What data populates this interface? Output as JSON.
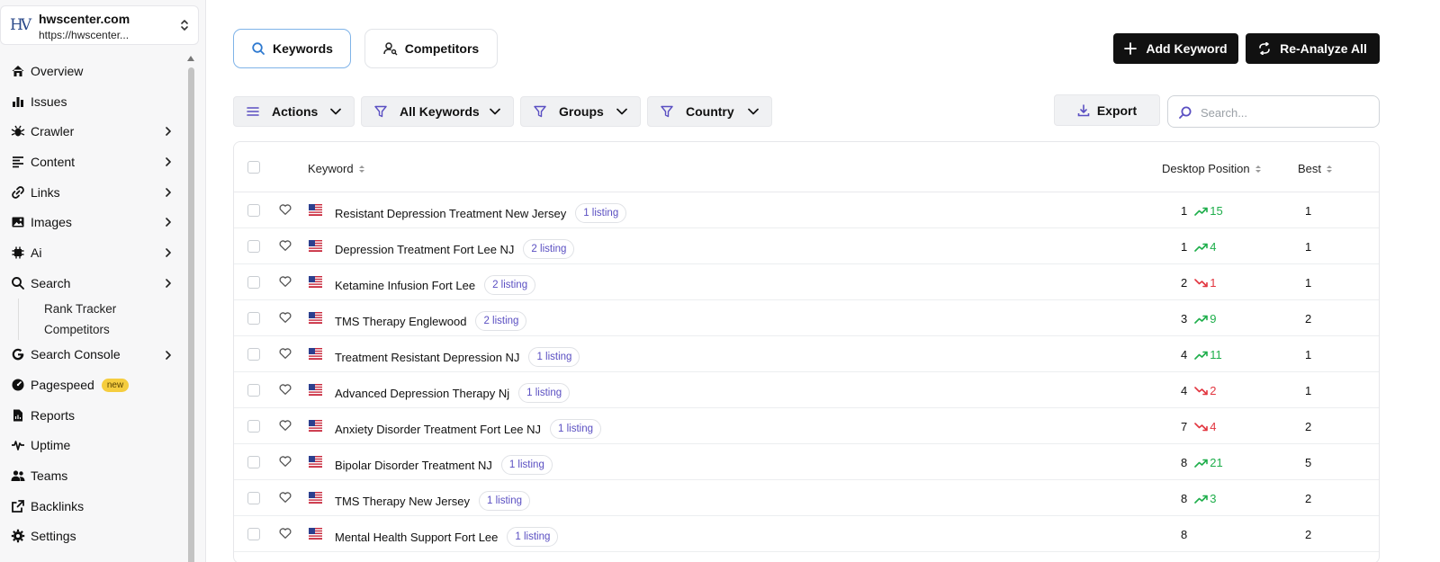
{
  "sidebar": {
    "site_name": "hwscenter.com",
    "site_url": "https://hwscenter...",
    "items": [
      {
        "label": "Overview",
        "icon": "home-icon",
        "chevron": false
      },
      {
        "label": "Issues",
        "icon": "bar-chart-icon",
        "chevron": false
      },
      {
        "label": "Crawler",
        "icon": "bug-icon",
        "chevron": true
      },
      {
        "label": "Content",
        "icon": "align-left-icon",
        "chevron": true
      },
      {
        "label": "Links",
        "icon": "link-icon",
        "chevron": true
      },
      {
        "label": "Images",
        "icon": "image-icon",
        "chevron": true
      },
      {
        "label": "Ai",
        "icon": "chip-icon",
        "chevron": true
      },
      {
        "label": "Search",
        "icon": "search-icon",
        "chevron": true
      }
    ],
    "search_subitems": [
      "Rank Tracker",
      "Competitors"
    ],
    "items_after": [
      {
        "label": "Search Console",
        "icon": "google-icon",
        "chevron": true
      },
      {
        "label": "Pagespeed",
        "icon": "speedometer-icon",
        "chevron": false,
        "badge": "new"
      },
      {
        "label": "Reports",
        "icon": "file-icon",
        "chevron": false
      },
      {
        "label": "Uptime",
        "icon": "pulse-icon",
        "chevron": false
      },
      {
        "label": "Teams",
        "icon": "users-icon",
        "chevron": false
      },
      {
        "label": "Backlinks",
        "icon": "external-link-icon",
        "chevron": false
      },
      {
        "label": "Settings",
        "icon": "gear-icon",
        "chevron": false
      }
    ]
  },
  "tabs": {
    "keywords": "Keywords",
    "competitors": "Competitors"
  },
  "actions": {
    "add_keyword": "Add Keyword",
    "reanalyze": "Re-Analyze All"
  },
  "filters": {
    "actions": "Actions",
    "all_keywords": "All Keywords",
    "groups": "Groups",
    "country": "Country"
  },
  "export_label": "Export",
  "search": {
    "placeholder": "Search..."
  },
  "table": {
    "headers": {
      "keyword": "Keyword",
      "desktop_position": "Desktop Position",
      "best": "Best"
    },
    "rows": [
      {
        "keyword": "Resistant Depression Treatment New Jersey",
        "listing": "1 listing",
        "position": "1",
        "change": "15",
        "direction": "up",
        "best": "1"
      },
      {
        "keyword": "Depression Treatment Fort Lee NJ",
        "listing": "2 listing",
        "position": "1",
        "change": "4",
        "direction": "up",
        "best": "1"
      },
      {
        "keyword": "Ketamine Infusion Fort Lee",
        "listing": "2 listing",
        "position": "2",
        "change": "1",
        "direction": "down",
        "best": "1"
      },
      {
        "keyword": "TMS Therapy Englewood",
        "listing": "2 listing",
        "position": "3",
        "change": "9",
        "direction": "up",
        "best": "2"
      },
      {
        "keyword": "Treatment Resistant Depression NJ",
        "listing": "1 listing",
        "position": "4",
        "change": "11",
        "direction": "up",
        "best": "1"
      },
      {
        "keyword": "Advanced Depression Therapy Nj",
        "listing": "1 listing",
        "position": "4",
        "change": "2",
        "direction": "down",
        "best": "1"
      },
      {
        "keyword": "Anxiety Disorder Treatment Fort Lee NJ",
        "listing": "1 listing",
        "position": "7",
        "change": "4",
        "direction": "down",
        "best": "2"
      },
      {
        "keyword": "Bipolar Disorder Treatment NJ",
        "listing": "1 listing",
        "position": "8",
        "change": "21",
        "direction": "up",
        "best": "5"
      },
      {
        "keyword": "TMS Therapy New Jersey",
        "listing": "1 listing",
        "position": "8",
        "change": "3",
        "direction": "up",
        "best": "2"
      },
      {
        "keyword": "Mental Health Support Fort Lee",
        "listing": "1 listing",
        "position": "8",
        "change": "",
        "direction": "none",
        "best": "2"
      }
    ]
  },
  "colors": {
    "up": "#1eae4b",
    "down": "#e2353f",
    "listing_text": "#5a4fc2",
    "primary_dark": "#111111",
    "badge_new": "#f5cd3f"
  }
}
